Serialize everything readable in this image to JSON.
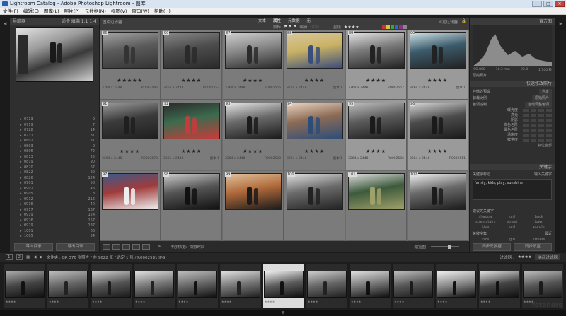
{
  "window": {
    "title": "Lightroom Catalog - Adobe Photoshop Lightroom - 图库",
    "buttons": [
      "–",
      "□",
      "✕"
    ]
  },
  "menu": [
    "文件(F)",
    "编辑(E)",
    "图库(L)",
    "照片(P)",
    "元数据(M)",
    "视图(V)",
    "窗口(W)",
    "帮助(H)"
  ],
  "navigator": {
    "title": "导航器",
    "zoom": "适合 填满 1:1 1:4"
  },
  "folders": [
    {
      "name": "0713",
      "count": "9"
    },
    {
      "name": "0719",
      "count": "7"
    },
    {
      "name": "0728",
      "count": "14"
    },
    {
      "name": "0731",
      "count": "31"
    },
    {
      "name": "0802",
      "count": "31"
    },
    {
      "name": "0803",
      "count": "9"
    },
    {
      "name": "0806",
      "count": "72"
    },
    {
      "name": "0813",
      "count": "25"
    },
    {
      "name": "0819",
      "count": "90"
    },
    {
      "name": "0820",
      "count": "67"
    },
    {
      "name": "0822",
      "count": "29"
    },
    {
      "name": "0826",
      "count": "124"
    },
    {
      "name": "0901",
      "count": "58"
    },
    {
      "name": "0902",
      "count": "48"
    },
    {
      "name": "0905",
      "count": "8"
    },
    {
      "name": "0912",
      "count": "216"
    },
    {
      "name": "0916",
      "count": "40"
    },
    {
      "name": "0917",
      "count": "137"
    },
    {
      "name": "0919",
      "count": "124"
    },
    {
      "name": "0926",
      "count": "157"
    },
    {
      "name": "0929",
      "count": "137"
    },
    {
      "name": "1001",
      "count": "86"
    },
    {
      "name": "1005",
      "count": "54"
    }
  ],
  "left_buttons": {
    "import": "导入目录",
    "export": "导出目录"
  },
  "filter": {
    "title": "图库过滤器",
    "tabs": [
      "文本",
      "属性",
      "元数据",
      "无"
    ],
    "active_tab": "属性",
    "custom": "自定过滤器",
    "flag_label": "旗标",
    "edit_label": "编辑",
    "rating_label": "星级",
    "rating_stars": "★★★★"
  },
  "grid": [
    {
      "num": "86",
      "stars": "★★★★★",
      "id": "R0002486",
      "sub": "3264 x 2448",
      "sel": false,
      "colors": [
        "#5b5b5b",
        "#333",
        "#a5a5a5"
      ]
    },
    {
      "num": "90",
      "stars": "★★★★",
      "id": "R0002553",
      "sub": "3264 x 2448",
      "sel": false,
      "colors": [
        "#4d4d4d",
        "#2a2a2a",
        "#888"
      ]
    },
    {
      "num": "87",
      "stars": "★★★★",
      "id": "R0002556",
      "sub": "3264 x 2448",
      "sel": false,
      "colors": [
        "#8a8a8a",
        "#2b2b2b",
        "#d0d0d0"
      ]
    },
    {
      "num": "88",
      "stars": "★★★★",
      "id": "副本 1",
      "sub": "3264 x 2448",
      "sel": false,
      "colors": [
        "#c9b264",
        "#3b4d7a",
        "#d9c8a0"
      ]
    },
    {
      "num": "89",
      "stars": "★★★★",
      "id": "R0002557",
      "sub": "3264 x 2448",
      "sel": true,
      "colors": [
        "#7a7a7a",
        "#222",
        "#e5e5e5"
      ]
    },
    {
      "num": "90",
      "stars": "★★★★",
      "id": "副本 1",
      "sub": "3264 x 2448",
      "sel": true,
      "colors": [
        "#3c5b6b",
        "#222",
        "#cfe3e8"
      ]
    },
    {
      "num": "91",
      "stars": "★★★★",
      "id": "R0002573",
      "sub": "3264 x 2448",
      "sel": false,
      "colors": [
        "#3b3b3b",
        "#1f1f1f",
        "#999"
      ]
    },
    {
      "num": "92",
      "stars": "★★★★",
      "id": "副本 1",
      "sub": "3264 x 2448",
      "sel": false,
      "colors": [
        "#3c6b4e",
        "#c83b3b",
        "#2a2a2a"
      ]
    },
    {
      "num": "93",
      "stars": "★★★★",
      "id": "R0002583",
      "sub": "3264 x 2448",
      "sel": false,
      "colors": [
        "#6a6a6a",
        "#1b1b1b",
        "#e5e5e5"
      ]
    },
    {
      "num": "94",
      "stars": "★★★★",
      "id": "副本 1",
      "sub": "3264 x 2448",
      "sel": false,
      "colors": [
        "#8c6b55",
        "#2c4d7a",
        "#e9d3c0"
      ]
    },
    {
      "num": "95",
      "stars": "★★★★",
      "id": "R0002586",
      "sub": "3264 x 2448",
      "sel": true,
      "colors": [
        "#5b5b5b",
        "#1b1b1b",
        "#bdbdbd"
      ]
    },
    {
      "num": "96",
      "stars": "★★★★",
      "id": "R0002611",
      "sub": "3264 x 2448",
      "sel": true,
      "colors": [
        "#4c4c4c",
        "#1a1a1a",
        "#d5d5d5"
      ]
    },
    {
      "num": "97",
      "stars": "",
      "id": "",
      "sub": "",
      "sel": false,
      "colors": [
        "#a03b3b",
        "#eee",
        "#3b5a8a"
      ]
    },
    {
      "num": "98",
      "stars": "",
      "id": "",
      "sub": "",
      "sel": false,
      "colors": [
        "#555",
        "#111",
        "#ccc"
      ]
    },
    {
      "num": "99",
      "stars": "",
      "id": "",
      "sub": "",
      "sel": false,
      "colors": [
        "#b06a3b",
        "#1b1b1b",
        "#e0c29b"
      ]
    },
    {
      "num": "100",
      "stars": "",
      "id": "",
      "sub": "",
      "sel": false,
      "colors": [
        "#6b6b6b",
        "#222",
        "#e0e0e0"
      ]
    },
    {
      "num": "101",
      "stars": "",
      "id": "",
      "sub": "",
      "sel": false,
      "colors": [
        "#3d5a3b",
        "#a0a06a",
        "#ddd"
      ]
    },
    {
      "num": "102",
      "stars": "",
      "id": "",
      "sub": "",
      "sel": false,
      "colors": [
        "#6a6a6a",
        "#1b1b1b",
        "#f0f0f0"
      ]
    }
  ],
  "center_toolbar": {
    "sort_label": "排序依据:",
    "sort_value": "拍摄时间",
    "thumbs": "缩览图"
  },
  "histogram": {
    "title": "直方图",
    "readouts": [
      "ISO 800",
      "18.3 mm",
      "f/2.8",
      "1/100 秒"
    ],
    "original": "原始照片"
  },
  "quick_develop": {
    "title": "快速修改照片",
    "preset_label": "存储的预设",
    "preset_value": "自定",
    "crop_label": "剪裁比例",
    "crop_value": "原始照片",
    "treatment_label": "处理方式",
    "treatment_value": "黑白",
    "color_label": "白平衡",
    "color_value": "自定",
    "tone_label": "色调控制",
    "tone_value": "自动调整色调",
    "rows": [
      "曝光度",
      "高光",
      "阴影",
      "白色色阶",
      "黑色色阶",
      "清晰度",
      "鲜艳度"
    ],
    "reset": "复位全部"
  },
  "keywording": {
    "title": "关键字",
    "tags_label": "关键字标记",
    "tags_value": "输入关键字",
    "tags_text": "family, kids, play, sunshine",
    "suggest_label": "建议的关键字",
    "suggest": [
      "shadow",
      "girl",
      "back",
      "streetstairs",
      "street",
      "town",
      "kids",
      "girl",
      "purple"
    ],
    "set_label": "关键字集",
    "set_value": "最近",
    "set_items": [
      "kids",
      "girl",
      "streets"
    ]
  },
  "right_buttons": {
    "sync_meta": "同步元数据",
    "sync_settings": "同步设置"
  },
  "filmbar": {
    "pages": [
      "1",
      "2"
    ],
    "source": "文件夹 : GR 376 张照片 / 共 9622 张 / 选定 1 张 / R0002581.JPG",
    "filter_label": "过滤器 :",
    "filter_stars": "★★★★",
    "filter_off": "关闭过滤器"
  },
  "filmstrip": [
    {
      "colors": [
        "#444",
        "#111",
        "#aaa"
      ]
    },
    {
      "colors": [
        "#666",
        "#222",
        "#bbb"
      ]
    },
    {
      "colors": [
        "#555",
        "#1b1b1b",
        "#ccc"
      ]
    },
    {
      "colors": [
        "#777",
        "#222",
        "#ddd"
      ]
    },
    {
      "colors": [
        "#666",
        "#111",
        "#bbb"
      ]
    },
    {
      "colors": [
        "#777",
        "#222",
        "#ddd"
      ]
    },
    {
      "colors": [
        "#5b5b5b",
        "#111",
        "#eee"
      ]
    },
    {
      "colors": [
        "#666",
        "#222",
        "#ccc"
      ]
    },
    {
      "colors": [
        "#777",
        "#111",
        "#ddd"
      ]
    },
    {
      "colors": [
        "#555",
        "#1b1b1b",
        "#bbb"
      ]
    },
    {
      "colors": [
        "#888",
        "#111",
        "#eee"
      ]
    },
    {
      "colors": [
        "#444",
        "#111",
        "#ddd"
      ]
    },
    {
      "colors": [
        "#555",
        "#1b1b1b",
        "#bbb"
      ]
    }
  ],
  "watermark": "fotor.org",
  "colors": {
    "accent": "#d8e4f2",
    "panel": "#2f2f2f",
    "grid_bg": "#6d6d6d",
    "selected": "#9a9a9a"
  }
}
